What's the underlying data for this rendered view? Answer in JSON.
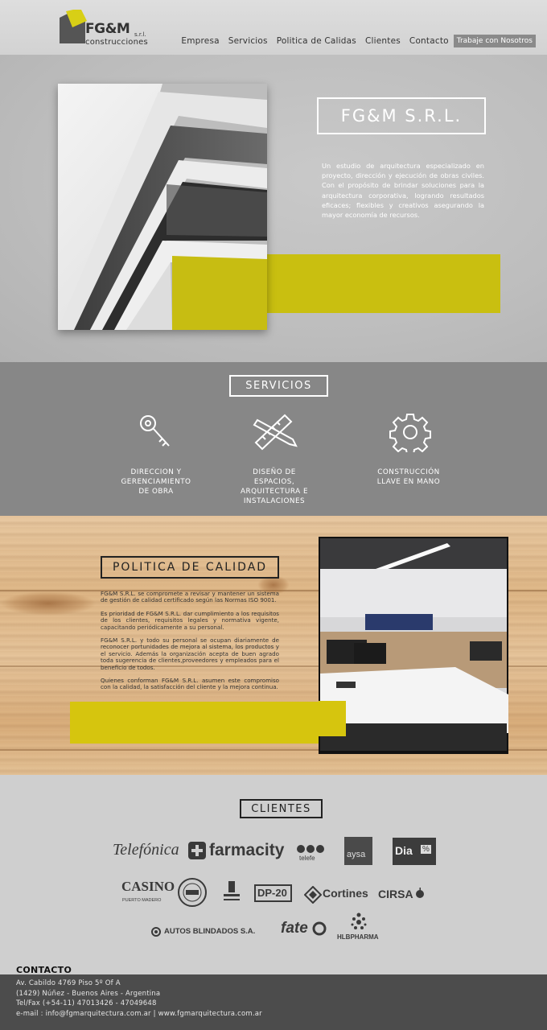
{
  "header": {
    "logo": {
      "name": "FG&M",
      "suffix": "s.r.l.",
      "subtitle": "construcciones"
    },
    "nav": [
      "Empresa",
      "Servicios",
      "Politica de Calidas",
      "Clientes",
      "Contacto"
    ],
    "cta": "Trabaje con Nosotros"
  },
  "hero": {
    "title": "FG&M S.R.L.",
    "text": "Un estudio de arquitectura especializado en proyecto, dirección y ejecución de obras civiles. Con el propósito de brindar soluciones para la arquitectura corporativa, logrando resultados eficaces; flexibles y creativos asegurando la mayor economía de recursos.",
    "accent_color": "#c9bf10"
  },
  "servicios": {
    "title": "SERVICIOS",
    "items": [
      {
        "icon": "key-icon",
        "line1": "DIRECCION Y",
        "line2": "GERENCIAMIENTO",
        "line3": "DE OBRA",
        "line4": ""
      },
      {
        "icon": "pencil-ruler-icon",
        "line1": "DISEÑO DE",
        "line2": "ESPACIOS,",
        "line3": "ARQUITECTURA E",
        "line4": "INSTALACIONES"
      },
      {
        "icon": "gear-icon",
        "line1": "CONSTRUCCIÓN",
        "line2": "LLAVE EN MANO",
        "line3": "",
        "line4": ""
      }
    ]
  },
  "politica": {
    "title": "POLITICA DE CALIDAD",
    "paragraphs": [
      "FG&M S.R.L. se compromete a revisar y mantener un sistema de gestión de calidad certificado según las Normas ISO 9001.",
      "Es prioridad de FG&M S.R.L. dar cumplimiento a los requisitos de los clientes, requisitos legales y normativa vigente, capacitando periódicamente a su personal.",
      "FG&M S.R.L. y todo su personal se ocupan diariamente de reconocer portunidades de mejora al sistema, los productos y el servicio. Además la organización acepta de buen agrado toda sugerencia de clientes,proveedores y empleados para el beneficio de todos.",
      "Quienes conforman FG&M S.R.L. asumen este compromiso con la calidad, la satisfacción del cliente y la mejora continua."
    ],
    "accent_color": "#d6c50e"
  },
  "clientes": {
    "title": "CLIENTES",
    "logos": {
      "telefonica": "Telefónica",
      "farmacity": "farmacity",
      "telefe": "telefe",
      "aysa": "aysa",
      "dia": "Dia",
      "dia_mark": "%",
      "casino": "CASINO",
      "casino_sub": "PUERTO MADERO",
      "dp20": "DP-20",
      "cortines": "Cortines",
      "cirsa": "CIRSA",
      "autos": "AUTOS BLINDADOS S.A.",
      "fate": "fate",
      "hlb": "HLBPHARMA"
    }
  },
  "footer": {
    "heading": "CONTACTO",
    "address": "Av. Cabildo 4769 Piso 5º Of A",
    "city": "(1429) Núñez - Buenos Aires - Argentina",
    "phone": "Tel/Fax (+54-11) 47013426 - 47049648",
    "web": "e-mail : info@fgmarquitectura.com.ar | www.fgmarquitectura.com.ar"
  }
}
